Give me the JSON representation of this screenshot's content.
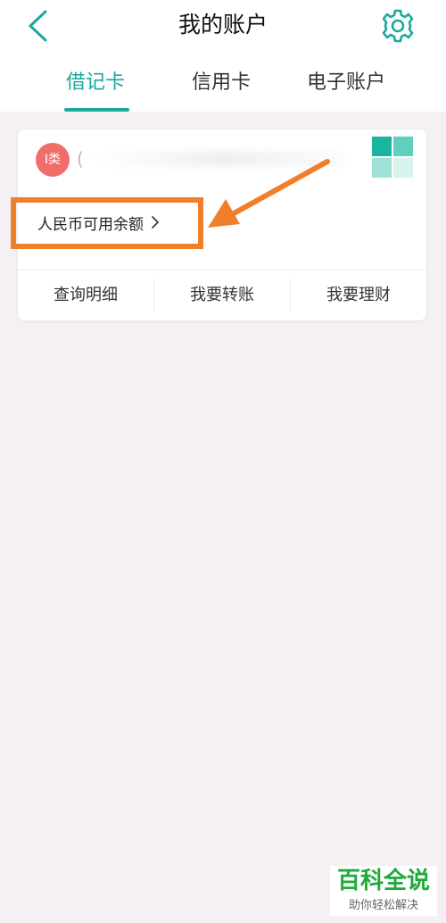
{
  "header": {
    "title": "我的账户"
  },
  "tabs": [
    {
      "label": "借记卡",
      "active": true
    },
    {
      "label": "信用卡",
      "active": false
    },
    {
      "label": "电子账户",
      "active": false
    }
  ],
  "card": {
    "class_badge": "I类",
    "account_glyph": "(",
    "balance_link": "人民币可用余额",
    "actions": [
      "查询明细",
      "我要转账",
      "我要理财"
    ]
  },
  "colors": {
    "accent": "#1aa99b",
    "badge": "#ef6e6a",
    "annotation": "#f07f2b",
    "background": "#f4f0f4"
  },
  "icons": {
    "back": "chevron-left-icon",
    "settings": "gear-icon",
    "balance_chevron": "chevron-right-icon",
    "bank_logo": "bank-logo"
  },
  "watermark": {
    "title": "百科全说",
    "subtitle": "助你轻松解决"
  }
}
